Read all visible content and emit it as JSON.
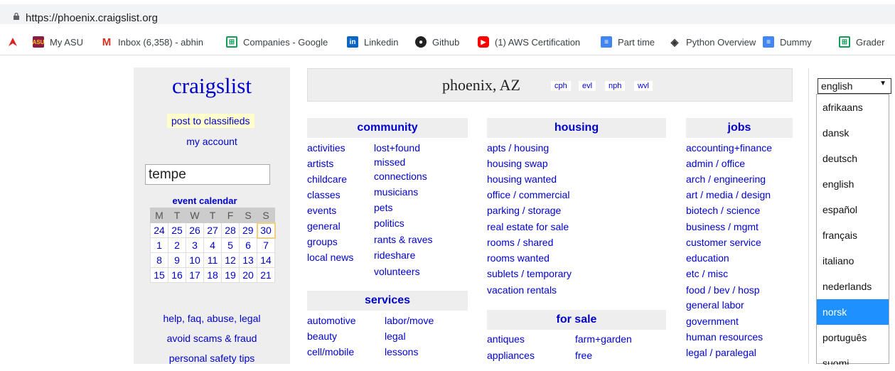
{
  "browser": {
    "url": "https://phoenix.craigslist.org",
    "bookmarks": [
      "My ASU",
      "Inbox (6,358) - abhin",
      "Companies - Google",
      "Linkedin",
      "Github",
      "(1) AWS Certification",
      "Part time",
      "Python Overview",
      "Dummy",
      "Grader"
    ]
  },
  "left": {
    "logo": "craigslist",
    "post": "post to classifieds",
    "account": "my account",
    "search_value": "tempe",
    "calendar_title": "event calendar",
    "days": [
      "M",
      "T",
      "W",
      "T",
      "F",
      "S",
      "S"
    ],
    "weeks": [
      [
        "24",
        "25",
        "26",
        "27",
        "28",
        "29",
        "30"
      ],
      [
        "1",
        "2",
        "3",
        "4",
        "5",
        "6",
        "7"
      ],
      [
        "8",
        "9",
        "10",
        "11",
        "12",
        "13",
        "14"
      ],
      [
        "15",
        "16",
        "17",
        "18",
        "19",
        "20",
        "21"
      ]
    ],
    "links": [
      "help, faq, abuse, legal",
      "avoid scams & fraud",
      "personal safety tips"
    ]
  },
  "header": {
    "city": "phoenix, AZ",
    "nearby": [
      "cph",
      "evl",
      "nph",
      "wvl"
    ]
  },
  "community": {
    "title": "community",
    "left": [
      "activities",
      "artists",
      "childcare",
      "classes",
      "events",
      "general",
      "groups",
      "local news"
    ],
    "right": [
      "lost+found",
      "missed",
      "connections",
      "musicians",
      "pets",
      "politics",
      "rants & raves",
      "rideshare",
      "volunteers"
    ]
  },
  "services": {
    "title": "services",
    "left": [
      "automotive",
      "beauty",
      "cell/mobile"
    ],
    "right": [
      "labor/move",
      "legal",
      "lessons"
    ]
  },
  "housing": {
    "title": "housing",
    "items": [
      "apts / housing",
      "housing swap",
      "housing wanted",
      "office / commercial",
      "parking / storage",
      "real estate for sale",
      "rooms / shared",
      "rooms wanted",
      "sublets / temporary",
      "vacation rentals"
    ]
  },
  "forsale": {
    "title": "for sale",
    "left": [
      "antiques",
      "appliances"
    ],
    "right": [
      "farm+garden",
      "free"
    ]
  },
  "jobs": {
    "title": "jobs",
    "items": [
      "accounting+finance",
      "admin / office",
      "arch / engineering",
      "art / media / design",
      "biotech / science",
      "business / mgmt",
      "customer service",
      "education",
      "etc / misc",
      "food / bev / hosp",
      "general labor",
      "government",
      "human resources",
      "legal / paralegal"
    ]
  },
  "language": {
    "selected": "english",
    "options": [
      "afrikaans",
      "dansk",
      "deutsch",
      "english",
      "español",
      "français",
      "italiano",
      "nederlands",
      "norsk",
      "português",
      "suomi"
    ],
    "highlighted": "norsk"
  }
}
